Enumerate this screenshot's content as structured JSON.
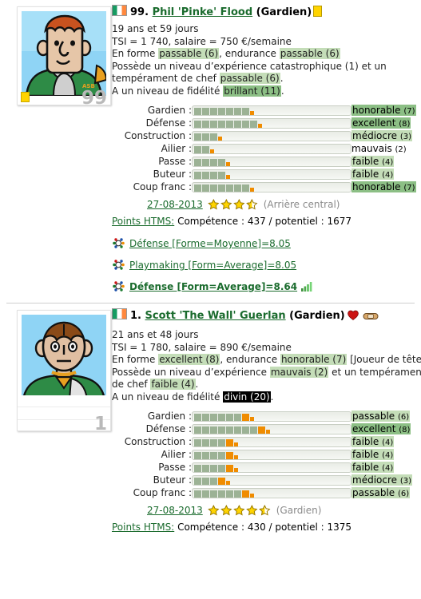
{
  "players": [
    {
      "rank": "99.",
      "name": "Phil 'Pinke' Flood",
      "position": "(Gardien)",
      "jersey_number": "99",
      "flag": "ireland-flag",
      "badges": [
        "yellow-card-badge"
      ],
      "age": "19 ans et 59 jours",
      "tsi_salary": "TSI = 1 740, salaire = 750 €/semaine",
      "form_prefix": "En forme ",
      "form_value": "passable (6)",
      "form_mid": ", endurance ",
      "stamina_value": "passable (6)",
      "form_suffix": "",
      "experience_prefix": "Possède un niveau d’expérience ",
      "experience_value": "catastrophique (1)",
      "experience_mid": " et un",
      "leadership_prefix": "tempérament de chef ",
      "leadership_value": "passable (6)",
      "leadership_suffix": ".",
      "loyalty_prefix": "A un niveau de fidélité ",
      "loyalty_value": "brillant (11)",
      "loyalty_suffix": ".",
      "skills": [
        {
          "label": "Gardien :",
          "blocks": 7,
          "full_orange": 0,
          "half": true,
          "value": "honorable",
          "level": "(7)",
          "tone": "dark"
        },
        {
          "label": "Défense :",
          "blocks": 8,
          "full_orange": 0,
          "half": true,
          "value": "excellent",
          "level": "(8)",
          "tone": "dark"
        },
        {
          "label": "Construction :",
          "blocks": 3,
          "full_orange": 0,
          "half": true,
          "value": "médiocre",
          "level": "(3)",
          "tone": "light"
        },
        {
          "label": "Ailier :",
          "blocks": 2,
          "full_orange": 0,
          "half": true,
          "value": "mauvais",
          "level": "(2)",
          "tone": "none"
        },
        {
          "label": "Passe :",
          "blocks": 4,
          "full_orange": 0,
          "half": true,
          "value": "faible",
          "level": "(4)",
          "tone": "light"
        },
        {
          "label": "Buteur :",
          "blocks": 4,
          "full_orange": 0,
          "half": true,
          "value": "faible",
          "level": "(4)",
          "tone": "light"
        },
        {
          "label": "Coup franc :",
          "blocks": 7,
          "full_orange": 0,
          "half": true,
          "value": "honorable",
          "level": "(7)",
          "tone": "dark"
        }
      ],
      "date": "27-08-2013",
      "stars": 3.5,
      "role": "(Arrière central)",
      "htms_label": "Points HTMS:",
      "htms_value": "Compétence : 437 / potentiel : 1677",
      "notes": [
        {
          "text": "Défense [Forme=Moyenne]=8.05",
          "bold": false,
          "chart": false
        },
        {
          "text": "Playmaking [Form=Average]=8.05",
          "bold": false,
          "chart": false
        },
        {
          "text": "Défense [Form=Average]=8.64",
          "bold": true,
          "chart": true
        }
      ]
    },
    {
      "rank": "1.",
      "name": "Scott 'The Wall' Guerlan",
      "position": "(Gardien)",
      "jersey_number": "1",
      "flag": "ireland-flag",
      "badges": [
        "heart-icon",
        "bandage-icon"
      ],
      "age": "21 ans et 48 jours",
      "tsi_salary": "TSI = 1 780, salaire = 890 €/semaine",
      "form_prefix": "En forme ",
      "form_value": "excellent (8)",
      "form_mid": ", endurance ",
      "stamina_value": "honorable (7)",
      "form_suffix": " [Joueur de tête]",
      "experience_prefix": "Possède un niveau d’expérience ",
      "experience_value": "mauvais (2)",
      "experience_mid": " et un tempérament",
      "leadership_prefix": "de chef ",
      "leadership_value": "faible (4)",
      "leadership_suffix": ".",
      "loyalty_prefix": "A un niveau de fidélité ",
      "loyalty_value": "divin (20)",
      "loyalty_suffix": ".",
      "skills": [
        {
          "label": "Gardien :",
          "blocks": 6,
          "full_orange": 1,
          "half": true,
          "value": "passable",
          "level": "(6)",
          "tone": "light"
        },
        {
          "label": "Défense :",
          "blocks": 8,
          "full_orange": 1,
          "half": true,
          "value": "excellent",
          "level": "(8)",
          "tone": "dark"
        },
        {
          "label": "Construction :",
          "blocks": 4,
          "full_orange": 1,
          "half": true,
          "value": "faible",
          "level": "(4)",
          "tone": "light"
        },
        {
          "label": "Ailier :",
          "blocks": 4,
          "full_orange": 1,
          "half": true,
          "value": "faible",
          "level": "(4)",
          "tone": "light"
        },
        {
          "label": "Passe :",
          "blocks": 4,
          "full_orange": 1,
          "half": true,
          "value": "faible",
          "level": "(4)",
          "tone": "light"
        },
        {
          "label": "Buteur :",
          "blocks": 3,
          "full_orange": 1,
          "half": true,
          "value": "médiocre",
          "level": "(3)",
          "tone": "light"
        },
        {
          "label": "Coup franc :",
          "blocks": 6,
          "full_orange": 1,
          "half": true,
          "value": "passable",
          "level": "(6)",
          "tone": "light"
        }
      ],
      "date": "27-08-2013",
      "stars": 4.5,
      "role": "(Gardien)",
      "htms_label": "Points HTMS:",
      "htms_value": "Compétence : 430 / potentiel : 1375",
      "notes": []
    }
  ],
  "colors": {
    "link_green": "#1a6b2d",
    "highlight_light": "#c4ddb8",
    "highlight_dark": "#8cbf85",
    "bar_block": "#9cb295",
    "bar_orange": "#f08c00",
    "star_yellow": "#ffd400"
  }
}
